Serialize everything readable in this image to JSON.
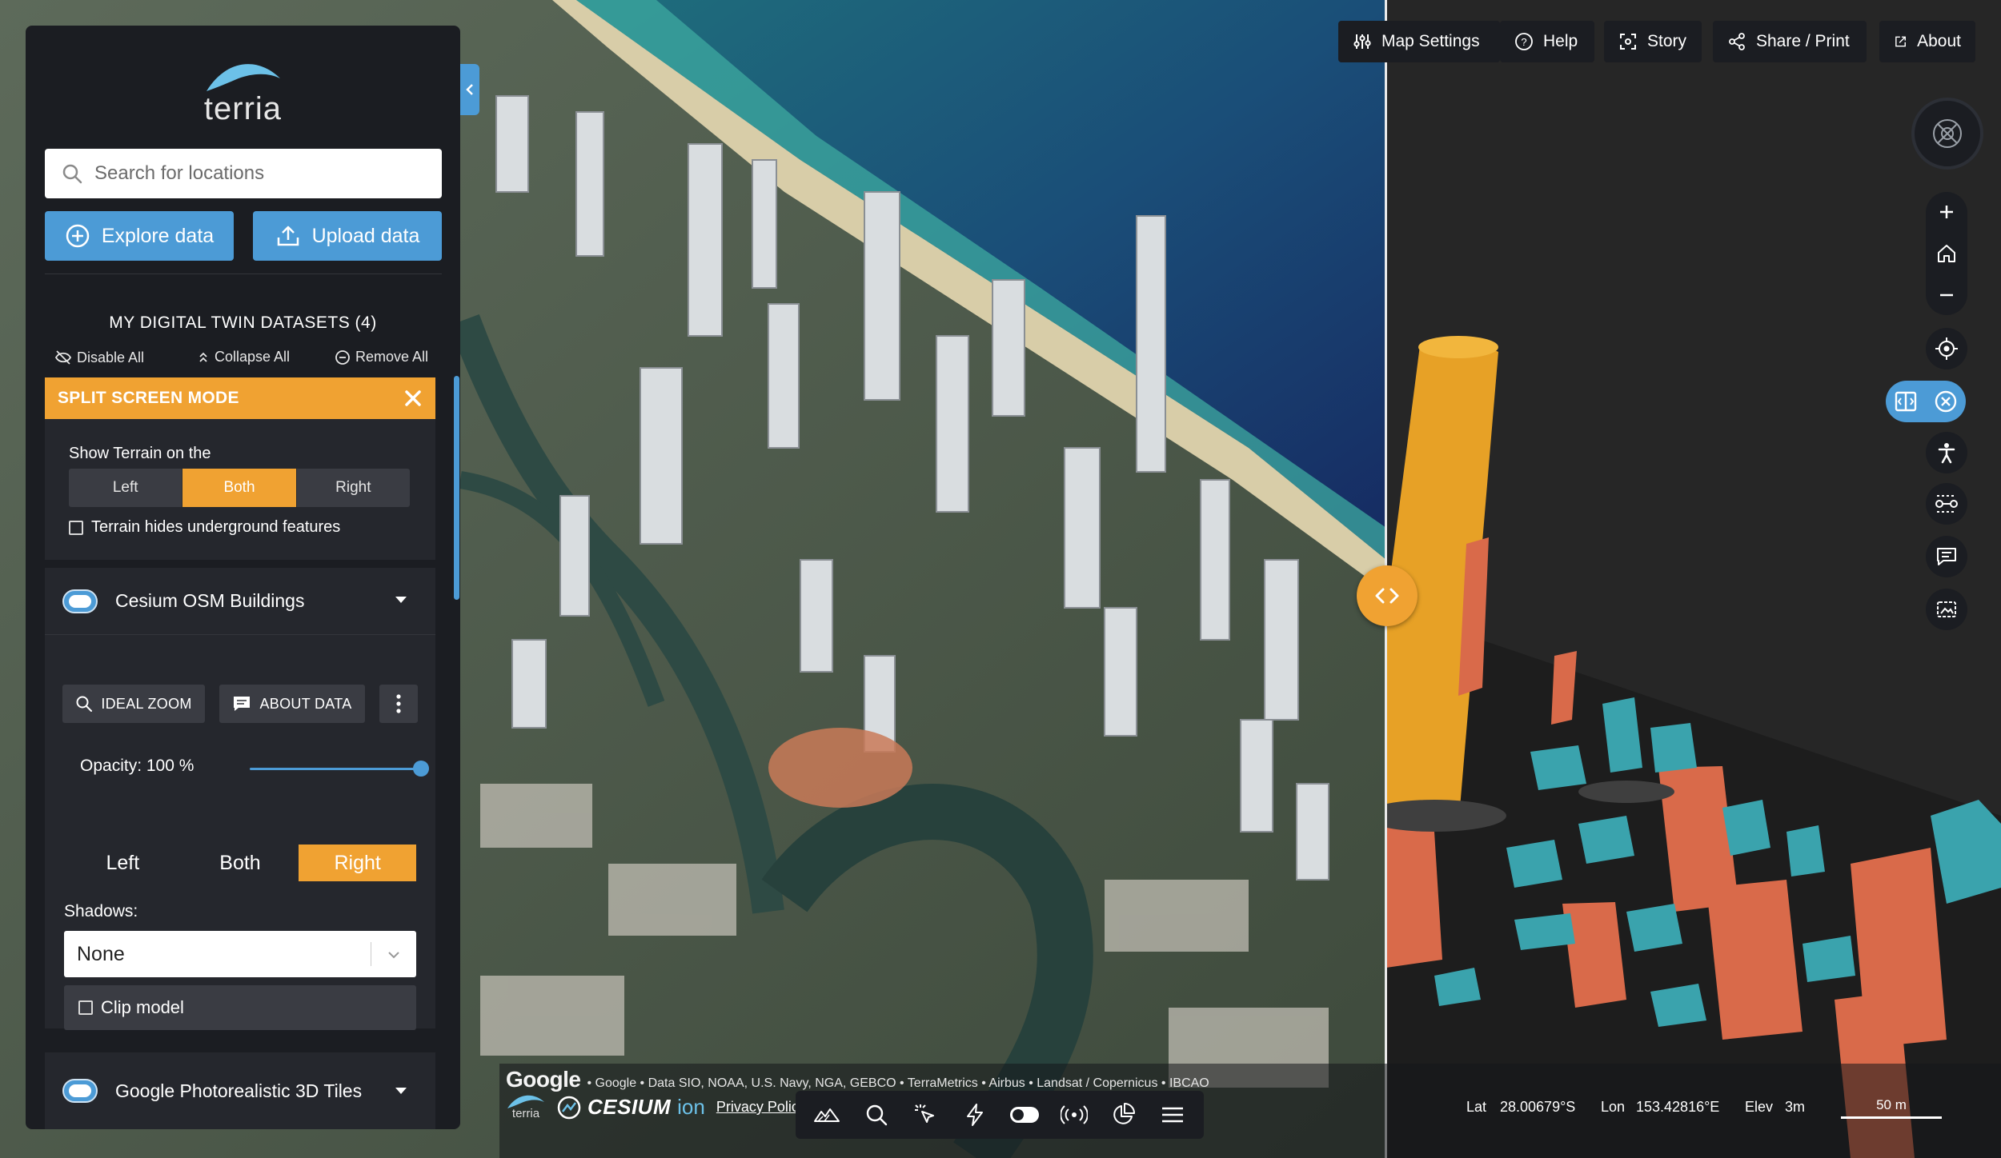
{
  "app": {
    "logo_text": "terria"
  },
  "search": {
    "placeholder": "Search for locations"
  },
  "actions": {
    "explore_label": "Explore data",
    "upload_label": "Upload data"
  },
  "workspace": {
    "title": "MY DIGITAL TWIN DATASETS (4)",
    "disable_all": "Disable All",
    "collapse_all": "Collapse All",
    "remove_all": "Remove All"
  },
  "split_screen": {
    "title": "SPLIT SCREEN MODE",
    "terrain_label": "Show Terrain on the",
    "options": [
      "Left",
      "Both",
      "Right"
    ],
    "selected": "Both",
    "terrain_hides_label": "Terrain hides underground features"
  },
  "dataset1": {
    "title": "Cesium OSM Buildings",
    "ideal_zoom": "IDEAL ZOOM",
    "about_data": "ABOUT DATA",
    "opacity_label": "Opacity: 100 %",
    "opacity_value": 100,
    "side_options": [
      "Left",
      "Both",
      "Right"
    ],
    "side_selected": "Right",
    "shadows_label": "Shadows:",
    "shadows_value": "None",
    "clip_label": "Clip model"
  },
  "dataset2": {
    "title": "Google Photorealistic 3D Tiles"
  },
  "toolbar": {
    "map_settings": "Map Settings",
    "help": "Help",
    "story": "Story",
    "share_print": "Share / Print",
    "about": "About"
  },
  "credits": {
    "google": "Google",
    "attribution": "• Google • Data SIO, NOAA, U.S. Navy, NGA, GEBCO • TerraMetrics • Airbus • Landsat / Copernicus • IBCAO",
    "cesium": "CESIUM",
    "ion": "ion",
    "privacy": "Privacy Polic",
    "terria_small": "terria"
  },
  "location": {
    "lat_label": "Lat",
    "lat_value": "28.00679°S",
    "lon_label": "Lon",
    "lon_value": "153.42816°E",
    "elev_label": "Elev",
    "elev_value": "3m",
    "scale_label": "50 m"
  },
  "colors": {
    "accent": "#f0a232",
    "primary": "#4c9bd6",
    "panel": "#1b1d22",
    "building_orange": "#d96a4a",
    "building_teal": "#3aa3ad",
    "building_yellow": "#e7a126"
  }
}
